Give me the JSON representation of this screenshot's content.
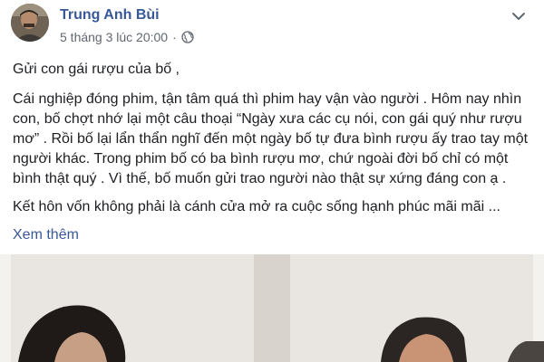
{
  "post": {
    "author": "Trung Anh Bùi",
    "timestamp": "5 tháng 3 lúc 20:00",
    "separator": "·",
    "privacy_icon": "globe-icon",
    "more_icon": "chevron-down-icon",
    "paragraphs": [
      "Gửi con gái rượu của bố ,",
      "Cái nghiệp đóng phim, tận tâm quá thì phim hay vận vào người . Hôm nay nhìn con, bố chợt nhớ lại một câu thoại “Ngày xưa các cụ nói, con gái quý như rượu mơ” . Rồi bố lại lẩn thẩn nghĩ đến một ngày bố tự đưa bình rượu ấy trao tay một người khác. Trong phim bố có ba bình rượu mơ, chứ ngoài đời bố chỉ có một bình thật quý . Vì thế, bố muốn gửi trao người nào thật sự xứng đáng con ạ .",
      "Kết hôn vốn không phải là cánh cửa mở ra cuộc sống hạnh phúc mãi mãi ..."
    ],
    "see_more": "Xem thêm"
  },
  "colors": {
    "author": "#385898",
    "meta": "#616770",
    "text": "#1c1e21",
    "link": "#385898"
  }
}
